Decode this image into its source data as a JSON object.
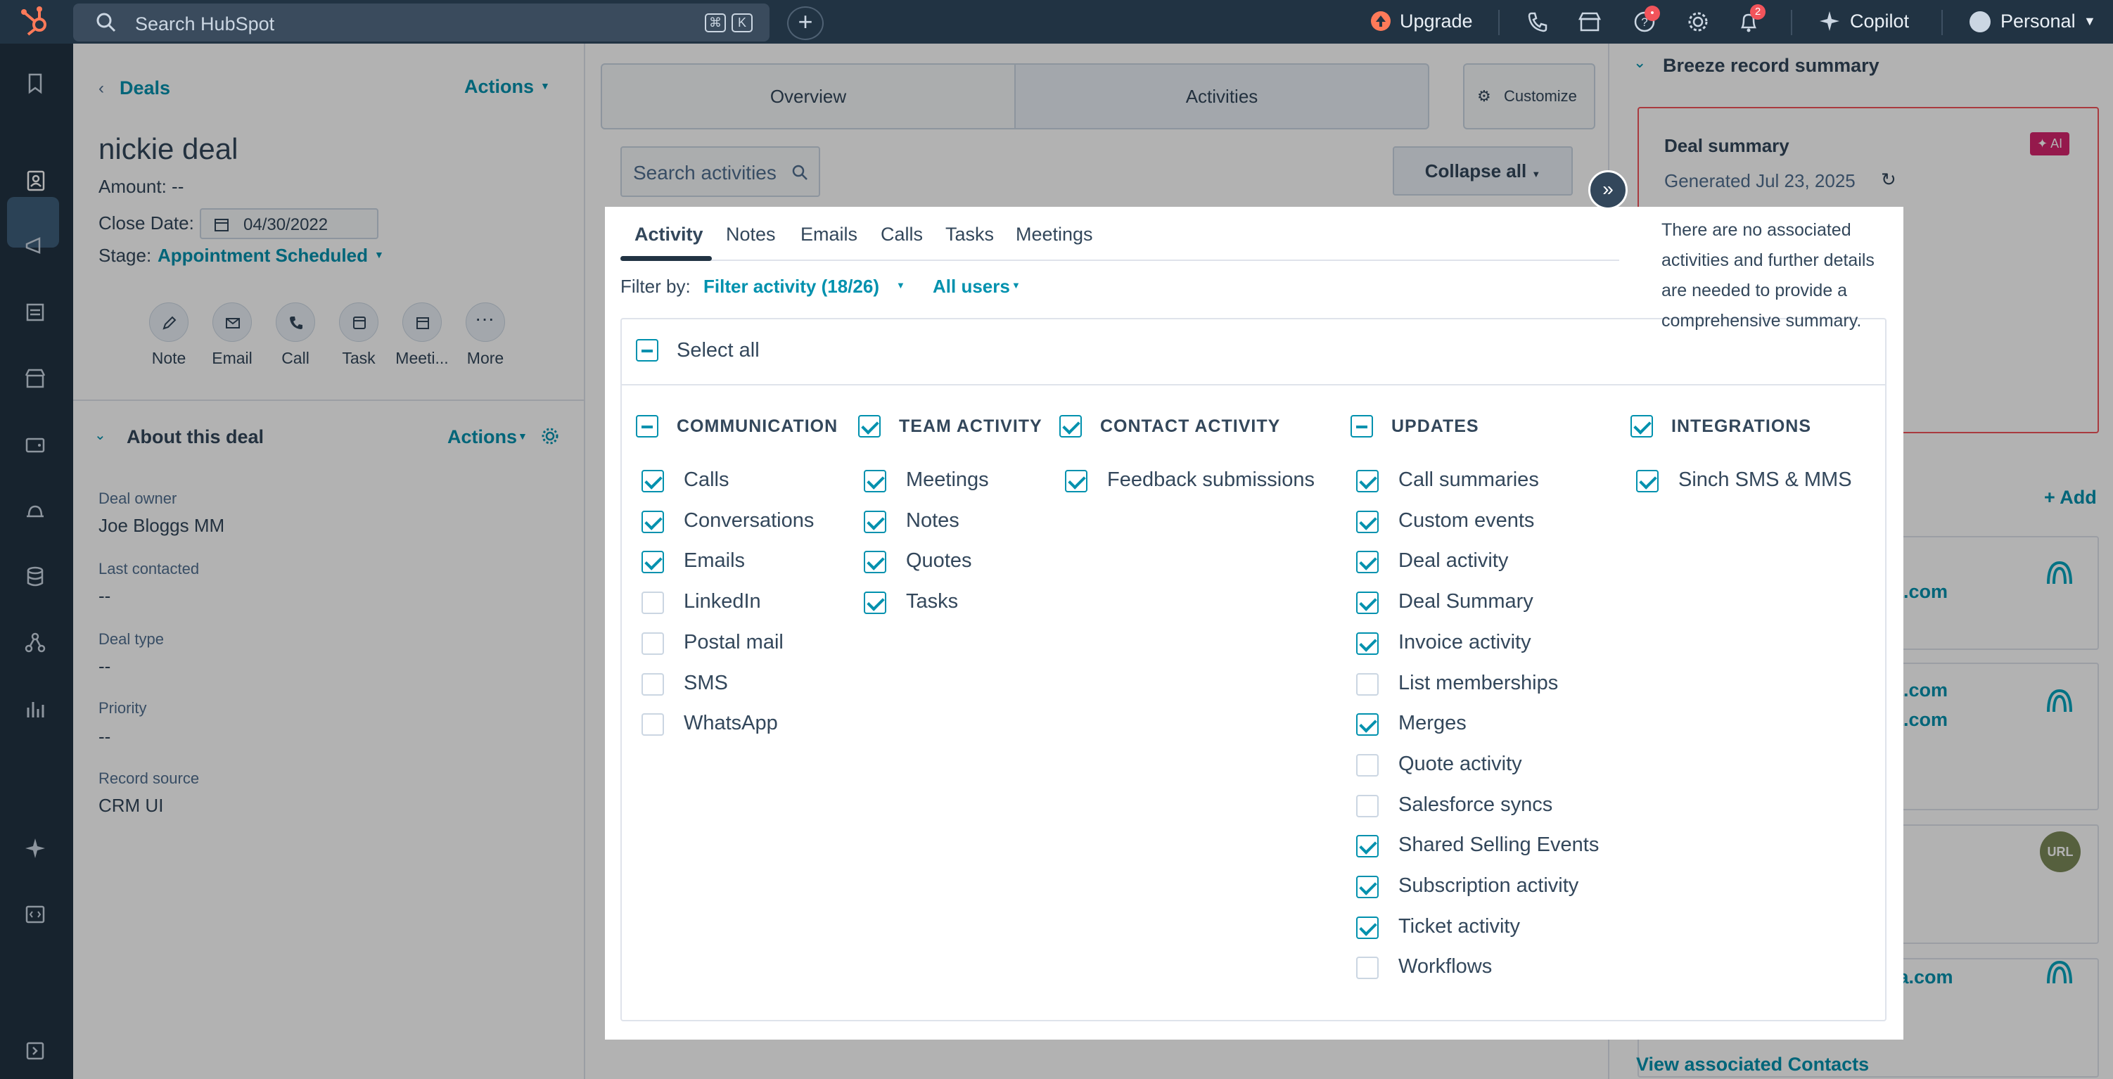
{
  "topbar": {
    "search_placeholder": "Search HubSpot",
    "kbd_cmd": "⌘",
    "kbd_k": "K",
    "upgrade": "Upgrade",
    "help_badge": "•",
    "notif_badge": "2",
    "copilot": "Copilot",
    "account": "Personal"
  },
  "left": {
    "back": "Deals",
    "actions": "Actions",
    "title": "nickie deal",
    "amount": "Amount: --",
    "close_label": "Close Date:",
    "close_value": "04/30/2022",
    "stage_label": "Stage:",
    "stage_value": "Appointment Scheduled",
    "quick_actions": [
      "Note",
      "Email",
      "Call",
      "Task",
      "Meeti...",
      "More"
    ],
    "about_title": "About this deal",
    "about_actions": "Actions",
    "fields": [
      {
        "label": "Deal owner",
        "value": "Joe Bloggs MM"
      },
      {
        "label": "Last contacted",
        "value": "--"
      },
      {
        "label": "Deal type",
        "value": "--"
      },
      {
        "label": "Priority",
        "value": "--"
      },
      {
        "label": "Record source",
        "value": "CRM UI"
      }
    ]
  },
  "middle": {
    "tab_overview": "Overview",
    "tab_activities": "Activities",
    "customize": "Customize",
    "search_activities": "Search activities",
    "collapse_all": "Collapse all"
  },
  "popup": {
    "subtabs": [
      "Activity",
      "Notes",
      "Emails",
      "Calls",
      "Tasks",
      "Meetings"
    ],
    "filter_by": "Filter by:",
    "filter_activity": "Filter activity (18/26)",
    "all_users": "All users",
    "select_all": "Select all",
    "columns": [
      {
        "title": "COMMUNICATION",
        "state": "ind",
        "items": [
          {
            "label": "Calls",
            "on": true
          },
          {
            "label": "Conversations",
            "on": true
          },
          {
            "label": "Emails",
            "on": true
          },
          {
            "label": "LinkedIn",
            "on": false
          },
          {
            "label": "Postal mail",
            "on": false
          },
          {
            "label": "SMS",
            "on": false
          },
          {
            "label": "WhatsApp",
            "on": false
          }
        ]
      },
      {
        "title": "TEAM ACTIVITY",
        "state": "on",
        "items": [
          {
            "label": "Meetings",
            "on": true
          },
          {
            "label": "Notes",
            "on": true
          },
          {
            "label": "Quotes",
            "on": true
          },
          {
            "label": "Tasks",
            "on": true
          }
        ]
      },
      {
        "title": "CONTACT ACTIVITY",
        "state": "on",
        "items": [
          {
            "label": "Feedback submissions",
            "on": true
          }
        ]
      },
      {
        "title": "UPDATES",
        "state": "ind",
        "items": [
          {
            "label": "Call summaries",
            "on": true
          },
          {
            "label": "Custom events",
            "on": true
          },
          {
            "label": "Deal activity",
            "on": true
          },
          {
            "label": "Deal Summary",
            "on": true
          },
          {
            "label": "Invoice activity",
            "on": true
          },
          {
            "label": "List memberships",
            "on": false
          },
          {
            "label": "Merges",
            "on": true
          },
          {
            "label": "Quote activity",
            "on": false
          },
          {
            "label": "Salesforce syncs",
            "on": false
          },
          {
            "label": "Shared Selling Events",
            "on": true
          },
          {
            "label": "Subscription activity",
            "on": true
          },
          {
            "label": "Ticket activity",
            "on": true
          },
          {
            "label": "Workflows",
            "on": false
          }
        ]
      },
      {
        "title": "INTEGRATIONS",
        "state": "on",
        "items": [
          {
            "label": "Sinch SMS & MMS",
            "on": true
          }
        ]
      }
    ]
  },
  "right": {
    "section_title": "Breeze record summary",
    "summary_title": "Deal summary",
    "ai_badge": "✦ AI",
    "generated": "Generated Jul 23, 2025",
    "summary_text": "There are no associated activities and further details are needed to provide a comprehensive summary.",
    "add": "+ Add",
    "emails": [
      "media.com",
      "media.com",
      "media.com",
      "gemedia.com"
    ],
    "view_contacts": "View associated Contacts",
    "url_badge": "URL"
  },
  "colors": {
    "accent": "#0091ae",
    "nav": "#213343",
    "badge": "#f2545b",
    "ai": "#d6246e"
  }
}
